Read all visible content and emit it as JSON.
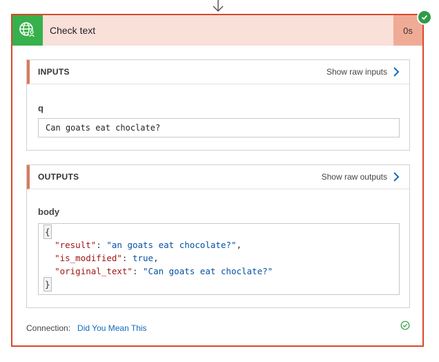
{
  "step": {
    "title": "Check text",
    "duration": "0s",
    "status_color": "#2e9b48",
    "accent_color": "#d9472b",
    "icon": "globe-user-icon"
  },
  "inputs": {
    "section_title": "INPUTS",
    "raw_link_label": "Show raw inputs",
    "field_label": "q",
    "field_value": "Can goats eat choclate?"
  },
  "outputs": {
    "section_title": "OUTPUTS",
    "raw_link_label": "Show raw outputs",
    "field_label": "body",
    "json_lines": {
      "open": "{",
      "result_key": "\"result\"",
      "result_value": "\"an goats eat chocolate?\"",
      "modified_key": "\"is_modified\"",
      "modified_value": "true",
      "original_key": "\"original_text\"",
      "original_value": "\"Can goats eat choclate?\"",
      "close": "}"
    }
  },
  "connection": {
    "label": "Connection:",
    "name": "Did You Mean This"
  }
}
